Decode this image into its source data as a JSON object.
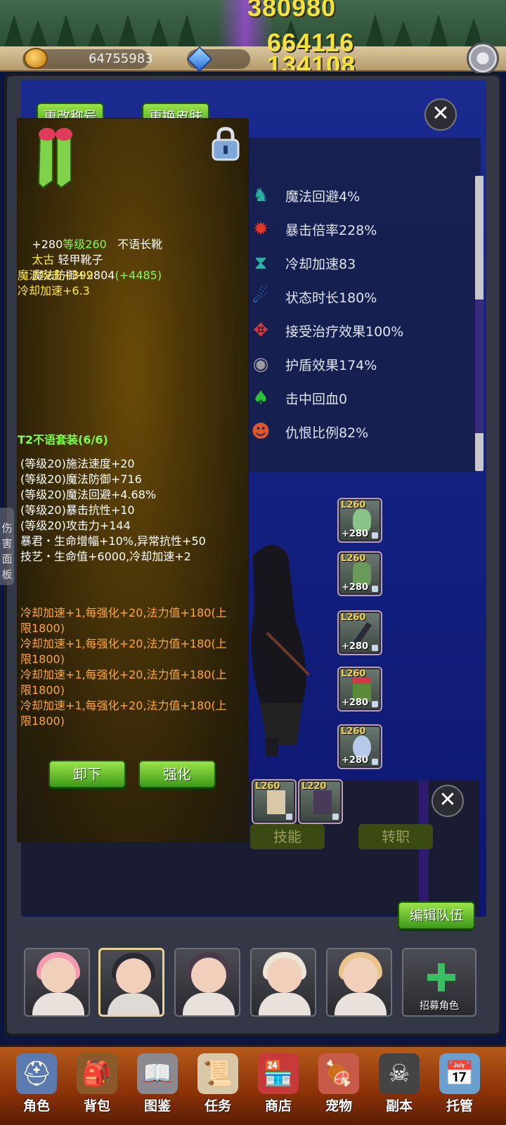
{
  "top": {
    "damage_numbers": [
      "380980",
      "664116",
      "134108"
    ],
    "gold": "64755983"
  },
  "profile_buttons": {
    "change_nickname": "更改称号",
    "change_skin": "更换皮肤"
  },
  "stats": [
    {
      "icon": "dodge-icon",
      "text": "魔法回避4%",
      "color": "#2bb5a0"
    },
    {
      "icon": "crit-rate-icon",
      "text": "暴击倍率228%",
      "color": "#e23a2a"
    },
    {
      "icon": "cooldown-icon",
      "text": "冷却加速83",
      "color": "#2bb5a0"
    },
    {
      "icon": "status-duration-icon",
      "text": "状态时长180%",
      "color": "#3a8ae0"
    },
    {
      "icon": "heal-received-icon",
      "text": "接受治疗效果100%",
      "color": "#d63a3a"
    },
    {
      "icon": "shield-effect-icon",
      "text": "护盾效果174%",
      "color": "#9a9aa0"
    },
    {
      "icon": "lifesteal-icon",
      "text": "击中回血0",
      "color": "#2bc23a"
    },
    {
      "icon": "threat-icon",
      "text": "仇恨比例82%",
      "color": "#e0552a"
    }
  ],
  "equip_slots_right": [
    {
      "level": "L260",
      "plus": "+280",
      "color": "#8ac38a"
    },
    {
      "level": "L260",
      "plus": "+280",
      "color": "#6a9a5a"
    },
    {
      "level": "L260",
      "plus": "+280",
      "color": "#2a2a3a"
    },
    {
      "level": "L260",
      "plus": "+280",
      "color": "#5a8a3a"
    },
    {
      "level": "L260",
      "plus": "+280",
      "color": "#b8c8e8"
    }
  ],
  "equip_slots_bottom": [
    {
      "level": "L260",
      "color": "#d8c8a8"
    },
    {
      "level": "L220",
      "color": "#4a3a5a"
    }
  ],
  "lower_buttons": {
    "skills": "技能",
    "class_change": "转职",
    "edit_team": "编辑队伍"
  },
  "tooltip": {
    "title_plus": "+280",
    "title_level": "等级260",
    "title_name": "不语长靴",
    "quality": "太古",
    "item_type": "轻甲靴子",
    "magic_def": "魔法防御+2804",
    "magic_def_bonus": "(+4485)",
    "magic_atk": "魔法攻击+399",
    "cooldown": "冷却加速+6.3",
    "set_title": "T2不语套装(6/6)",
    "set_bonuses": [
      "(等级20)施法速度+20",
      "(等级20)魔法防御+716",
      "(等级20)魔法回避+4.68%",
      "(等级20)暴击抗性+10",
      "(等级20)攻击力+144",
      "暴君・生命增幅+10%,异常抗性+50",
      "技艺・生命值+6000,冷却加速+2"
    ],
    "enchant_lines": [
      "冷却加速+1,每强化+20,法力值+180(上",
      "限1800)",
      "冷却加速+1,每强化+20,法力值+180(上",
      "限1800)",
      "冷却加速+1,每强化+20,法力值+180(上",
      "限1800)",
      "冷却加速+1,每强化+20,法力值+180(上",
      "限1800)"
    ],
    "unequip_button": "卸下",
    "enhance_button": "强化"
  },
  "side_tab": [
    "伤",
    "害",
    "面",
    "板"
  ],
  "roster": {
    "heroes": [
      {
        "hair": "#f29ab0"
      },
      {
        "hair": "#2a2a30"
      },
      {
        "hair": "#4a3a4a"
      },
      {
        "hair": "#ece6d6"
      },
      {
        "hair": "#e9c48a"
      }
    ],
    "recruit_label": "招募角色"
  },
  "nav": [
    {
      "icon": "helmet-icon",
      "label": "角色",
      "color": "#5a7ab0"
    },
    {
      "icon": "backpack-icon",
      "label": "背包",
      "color": "#8a5a2a"
    },
    {
      "icon": "book-icon",
      "label": "图鉴",
      "color": "#8a8a90"
    },
    {
      "icon": "scroll-icon",
      "label": "任务",
      "color": "#d8c8a8"
    },
    {
      "icon": "shop-icon",
      "label": "商店",
      "color": "#c83a3a"
    },
    {
      "icon": "meat-icon",
      "label": "宠物",
      "color": "#c85a4a"
    },
    {
      "icon": "skull-icon",
      "label": "副本",
      "color": "#444"
    },
    {
      "icon": "calendar-icon",
      "label": "托管",
      "color": "#6aa0d0"
    }
  ]
}
